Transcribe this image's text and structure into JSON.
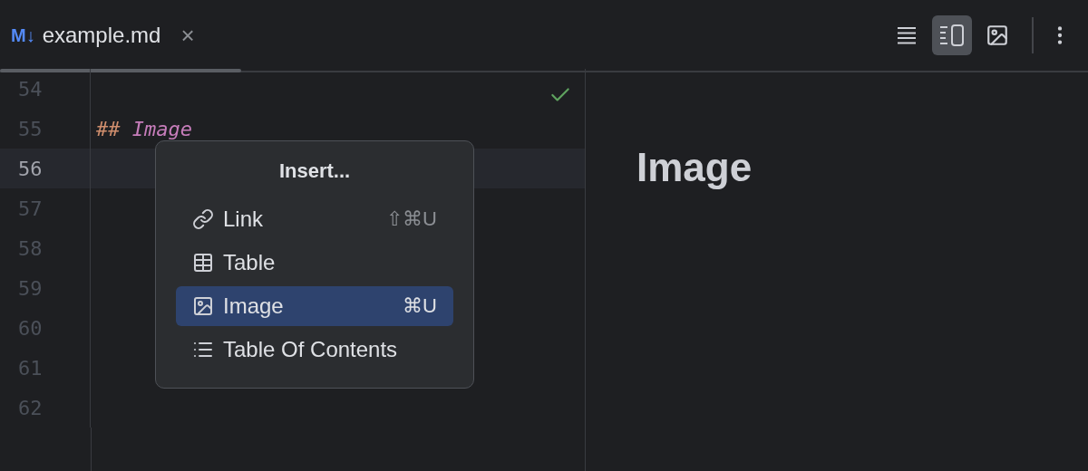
{
  "tab": {
    "badge": "M↓",
    "title": "example.md",
    "close": "×"
  },
  "view_buttons": [
    {
      "kind": "editor",
      "selected": false
    },
    {
      "kind": "split",
      "selected": true
    },
    {
      "kind": "preview",
      "selected": false
    }
  ],
  "editor": {
    "lines": [
      {
        "number": "54",
        "current": false
      },
      {
        "number": "55",
        "current": false,
        "marker": "##",
        "text": "Image"
      },
      {
        "number": "56",
        "current": true
      },
      {
        "number": "57",
        "current": false
      },
      {
        "number": "58",
        "current": false
      },
      {
        "number": "59",
        "current": false
      },
      {
        "number": "60",
        "current": false
      },
      {
        "number": "61",
        "current": false
      },
      {
        "number": "62",
        "current": false
      }
    ]
  },
  "popup": {
    "title": "Insert...",
    "items": [
      {
        "kind": "link",
        "label": "Link",
        "shortcut": "⇧⌘U",
        "selected": false
      },
      {
        "kind": "table",
        "label": "Table",
        "selected": false
      },
      {
        "kind": "image",
        "label": "Image",
        "shortcut": "⌘U",
        "selected": true
      },
      {
        "kind": "toc",
        "label": "Table Of Contents",
        "selected": false
      }
    ]
  },
  "preview": {
    "heading": "Image"
  }
}
